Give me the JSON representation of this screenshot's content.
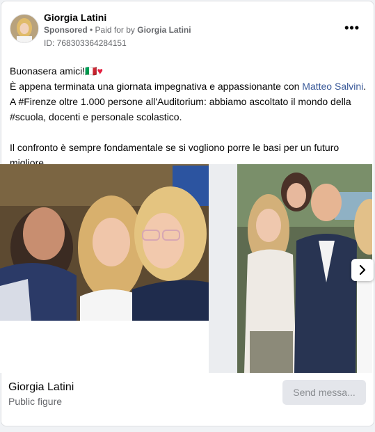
{
  "post": {
    "page_name": "Giorgia Latini",
    "sponsored_label": "Sponsored",
    "paid_prefix": " • Paid for by ",
    "paid_by": "Giorgia Latini",
    "ad_id": "ID: 768303364284151",
    "more_icon": "more-horizontal-icon",
    "text_line1_start": "Buonasera amici!",
    "text_line1_emoji": "🇮🇹",
    "text_line2_start": "È appena terminata una giornata impegnativa e appassionante con ",
    "text_line2_link": "Matteo Salvini",
    "text_line2_end": ".",
    "text_line3": "A #Firenze oltre 1.000 persone all'Auditorium: abbiamo ascoltato il mondo della",
    "text_line4": "#scuola, docenti e personale scolastico.",
    "text_line6": "Il confronto è sempre fondamentale se si vogliono porre le basi per un futuro",
    "text_line7": "migliore...."
  },
  "footer": {
    "name": "Giorgia Latini",
    "category": "Public figure",
    "cta_label": "Send messa..."
  },
  "colors": {
    "link": "#385898",
    "heart": "#e41e3f",
    "muted": "#65676b"
  }
}
